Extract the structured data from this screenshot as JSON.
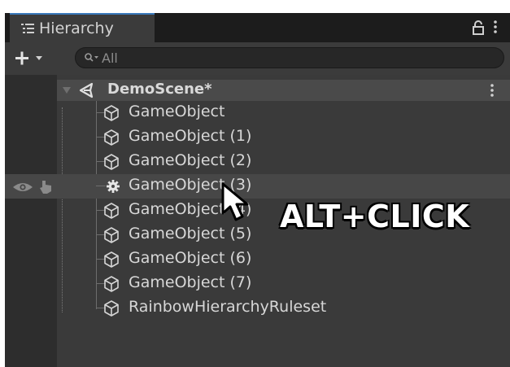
{
  "window": {
    "tab_title": "Hierarchy",
    "tab_icon": "hierarchy-list-icon",
    "lock_icon": "lock-icon",
    "menu_icon": "kebab-menu-icon"
  },
  "toolbar": {
    "create_button_icon": "plus-dropdown-icon",
    "search": {
      "placeholder": "All",
      "value": "",
      "icon": "search-filter-icon"
    }
  },
  "scene": {
    "name": "DemoScene*",
    "expanded": true,
    "icon": "unity-scene-icon",
    "menu_icon": "kebab-menu-icon"
  },
  "items": [
    {
      "label": "GameObject",
      "icon": "cube-icon"
    },
    {
      "label": "GameObject (1)",
      "icon": "cube-icon"
    },
    {
      "label": "GameObject (2)",
      "icon": "cube-icon"
    },
    {
      "label": "GameObject (3)",
      "icon": "gear-icon",
      "hovered": true
    },
    {
      "label": "GameObject (4)",
      "icon": "cube-icon"
    },
    {
      "label": "GameObject (5)",
      "icon": "cube-icon"
    },
    {
      "label": "GameObject (6)",
      "icon": "cube-icon"
    },
    {
      "label": "GameObject (7)",
      "icon": "cube-icon"
    },
    {
      "label": "RainbowHierarchyRuleset",
      "icon": "cube-icon"
    }
  ],
  "gutter": {
    "visibility_icon": "eye-icon",
    "pickable_icon": "hand-pointer-icon"
  },
  "overlay": {
    "caption": "ALT+CLICK",
    "cursor_icon": "arrow-cursor-icon"
  },
  "colors": {
    "accent_tab": "#3a79bb",
    "panel_background": "#3a3a3a",
    "scene_row": "#4a4a4a",
    "text": "#d7d7d7"
  }
}
